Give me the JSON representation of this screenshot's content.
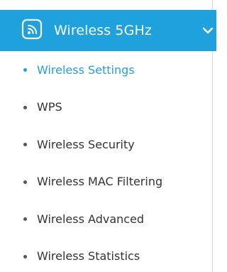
{
  "colors": {
    "accent": "#1ea1dd",
    "text": "#333333",
    "header_text": "#ffffff"
  },
  "header": {
    "title": "Wireless 5GHz",
    "icon": "wifi-icon",
    "toggle_icon": "chevron-down-icon",
    "expanded": true
  },
  "menu": {
    "items": [
      {
        "label": "Wireless Settings",
        "active": true
      },
      {
        "label": "WPS",
        "active": false
      },
      {
        "label": "Wireless Security",
        "active": false
      },
      {
        "label": "Wireless MAC Filtering",
        "active": false
      },
      {
        "label": "Wireless Advanced",
        "active": false
      },
      {
        "label": "Wireless Statistics",
        "active": false
      }
    ]
  }
}
